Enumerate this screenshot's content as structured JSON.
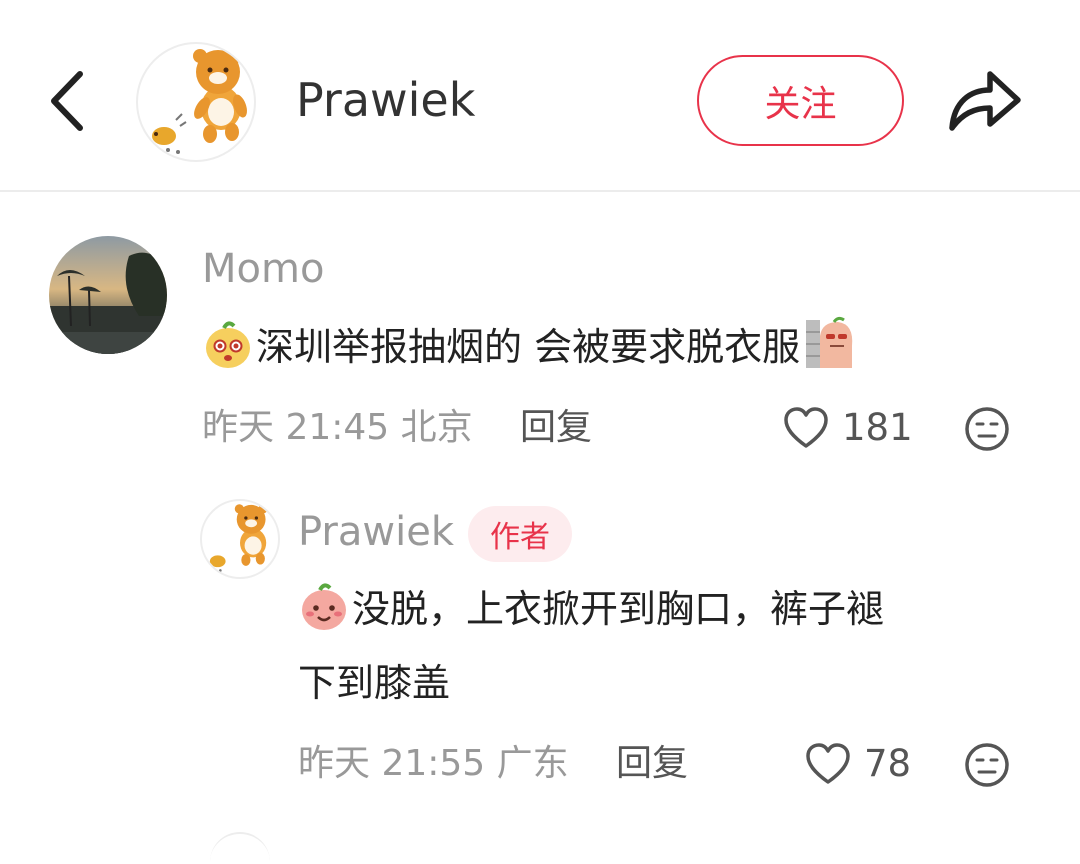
{
  "header": {
    "back_icon": "chevron-left-icon",
    "author_name": "Prawiek",
    "follow_label": "关注",
    "share_icon": "share-arrow-icon"
  },
  "colors": {
    "accent": "#e8334a",
    "badge_bg": "#fdecee",
    "secondary_text": "#999999"
  },
  "comments": [
    {
      "user": "Momo",
      "content": "深圳举报抽烟的 会被要求脱衣服",
      "time": "昨天 21:45 北京",
      "reply_label": "回复",
      "likes": "181"
    }
  ],
  "replies": [
    {
      "user": "Prawiek",
      "badge": "作者",
      "content_line1": "没脱，上衣掀开到胸口，裤子褪",
      "content_line2": "下到膝盖",
      "time": "昨天 21:55 广东",
      "reply_label": "回复",
      "likes": "78"
    }
  ]
}
